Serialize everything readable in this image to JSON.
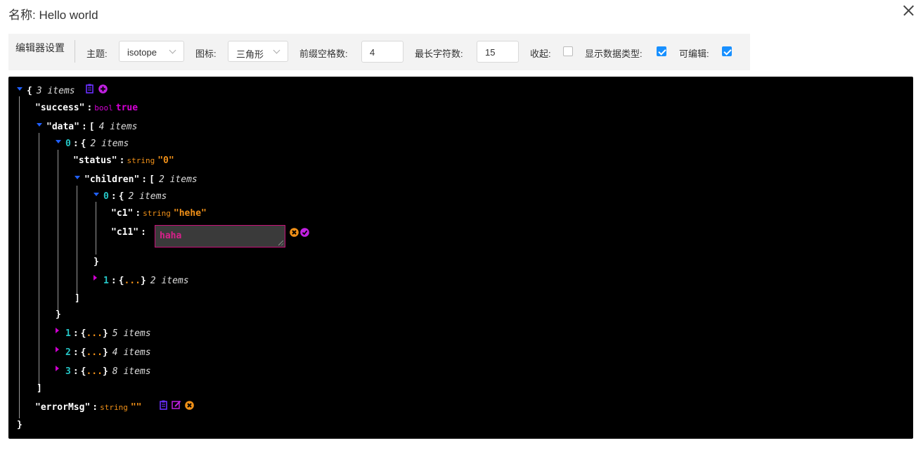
{
  "header": {
    "title": "名称: Hello world"
  },
  "settings": {
    "section_label": "编辑器设置",
    "theme": {
      "label": "主题:",
      "value": "isotope"
    },
    "icon_style": {
      "label": "图标:",
      "value": "三角形"
    },
    "indent": {
      "label": "前缀空格数:",
      "value": "4"
    },
    "max_string": {
      "label": "最长字符数:",
      "value": "15"
    },
    "collapse": {
      "label": "收起:",
      "checked": false
    },
    "show_types": {
      "label": "显示数据类型:",
      "checked": true
    },
    "editable": {
      "label": "可编辑:",
      "checked": true
    }
  },
  "tree": {
    "root": {
      "open": "{",
      "close": "}",
      "meta": "3 items"
    },
    "success": {
      "key": "\"success\"",
      "colon": ":",
      "type": "bool",
      "value": "true"
    },
    "data": {
      "key": "\"data\"",
      "colon": ":",
      "open": "[",
      "close": "]",
      "meta": "4 items"
    },
    "item0": {
      "index": "0",
      "colon": ":",
      "open": "{",
      "close": "}",
      "meta": "2 items"
    },
    "status": {
      "key": "\"status\"",
      "colon": ":",
      "type": "string",
      "value": "\"0\""
    },
    "children": {
      "key": "\"children\"",
      "colon": ":",
      "open": "[",
      "close": "]",
      "meta": "2 items"
    },
    "child0": {
      "index": "0",
      "colon": ":",
      "open": "{",
      "close": "}",
      "meta": "2 items"
    },
    "c1": {
      "key": "\"c1\"",
      "colon": ":",
      "type": "string",
      "value": "\"hehe\""
    },
    "c11": {
      "key": "\"c11\"",
      "colon": ":",
      "edit_value": "haha"
    },
    "child1": {
      "index": "1",
      "colon": ":",
      "open": "{",
      "dots": "...",
      "close": "}",
      "meta": "2 items"
    },
    "item1": {
      "index": "1",
      "colon": ":",
      "open": "{",
      "dots": "...",
      "close": "}",
      "meta": "5 items"
    },
    "item2": {
      "index": "2",
      "colon": ":",
      "open": "{",
      "dots": "...",
      "close": "}",
      "meta": "4 items"
    },
    "item3": {
      "index": "3",
      "colon": ":",
      "open": "{",
      "dots": "...",
      "close": "}",
      "meta": "8 items"
    },
    "errorMsg": {
      "key": "\"errorMsg\"",
      "colon": ":",
      "type": "string",
      "value": "\"\""
    }
  },
  "colors": {
    "background": "#000000",
    "key": "#ffffff",
    "index": "#25c6c6",
    "bool": "#d500d5",
    "string": "#f09018",
    "expand": "#2060ff",
    "collapse": "#d000d0"
  },
  "icons": [
    "copy-icon",
    "add-icon",
    "cancel-icon",
    "confirm-icon",
    "edit-icon",
    "remove-icon",
    "close-icon"
  ]
}
